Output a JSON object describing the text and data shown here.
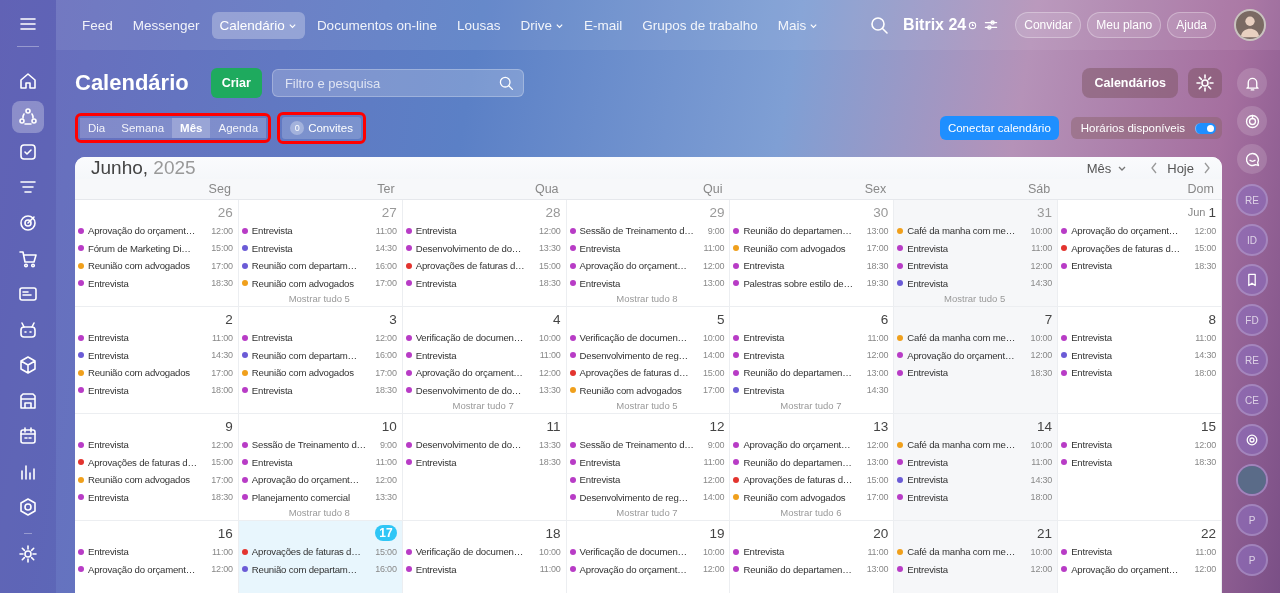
{
  "left_sidebar": {
    "items": [
      {
        "selected": false
      },
      {
        "selected": true
      },
      {
        "selected": false
      },
      {
        "selected": false
      },
      {
        "selected": false
      },
      {
        "selected": false
      },
      {
        "selected": false
      },
      {
        "selected": false
      },
      {
        "selected": false
      },
      {
        "selected": false
      },
      {
        "selected": false
      },
      {
        "selected": false
      },
      {
        "selected": false
      }
    ]
  },
  "top_nav": {
    "items": [
      {
        "label": "Feed",
        "selected": false,
        "dropdown": false
      },
      {
        "label": "Messenger",
        "selected": false,
        "dropdown": false
      },
      {
        "label": "Calendário",
        "selected": true,
        "dropdown": true
      },
      {
        "label": "Documentos on-line",
        "selected": false,
        "dropdown": false
      },
      {
        "label": "Lousas",
        "selected": false,
        "dropdown": false
      },
      {
        "label": "Drive",
        "selected": false,
        "dropdown": true
      },
      {
        "label": "E-mail",
        "selected": false,
        "dropdown": false
      },
      {
        "label": "Grupos de trabalho",
        "selected": false,
        "dropdown": false
      },
      {
        "label": "Mais",
        "selected": false,
        "dropdown": true
      }
    ],
    "logo": {
      "name": "Bitrix",
      "number": "24"
    },
    "buttons": [
      "Convidar",
      "Meu plano",
      "Ajuda"
    ]
  },
  "page": {
    "title": "Calendário",
    "create_button": "Criar",
    "search": {
      "placeholder": "Filtro e pesquisa"
    },
    "calendars_button": "Calendários",
    "views": [
      {
        "label": "Dia",
        "selected": false
      },
      {
        "label": "Semana",
        "selected": false
      },
      {
        "label": "Mês",
        "selected": true
      },
      {
        "label": "Agenda",
        "selected": false
      }
    ],
    "invites": {
      "count": "0",
      "label": "Convites"
    },
    "connect_button": "Conectar calendário",
    "availability": {
      "label": "Horários disponíveis",
      "on": true
    }
  },
  "calendar": {
    "month": "Junho,",
    "year": "2025",
    "view_select": "Mês",
    "today_button": "Hoje",
    "weekdays": [
      "Seg",
      "Ter",
      "Qua",
      "Qui",
      "Sex",
      "Sáb",
      "Dom"
    ],
    "weeks": [
      {
        "days": [
          {
            "number": "26",
            "other_month": true,
            "today": false,
            "events": [
              {
                "title": "Aprovação do orçament…",
                "time": "12:00",
                "color": "#b83cc6"
              },
              {
                "title": "Fórum de Marketing Di…",
                "time": "15:00",
                "color": "#b83cc6"
              },
              {
                "title": "Reunião com advogados",
                "time": "17:00",
                "color": "#f0a01c"
              },
              {
                "title": "Entrevista",
                "time": "18:30",
                "color": "#b83cc6"
              }
            ]
          },
          {
            "number": "27",
            "other_month": true,
            "today": false,
            "events": [
              {
                "title": "Entrevista",
                "time": "11:00",
                "color": "#b83cc6"
              },
              {
                "title": "Entrevista",
                "time": "14:30",
                "color": "#6b5bd6"
              },
              {
                "title": "Reunião com departam…",
                "time": "16:00",
                "color": "#6b5bd6"
              },
              {
                "title": "Reunião com advogados",
                "time": "17:00",
                "color": "#f0a01c"
              }
            ],
            "more": "Mostrar tudo 5"
          },
          {
            "number": "28",
            "other_month": true,
            "today": false,
            "events": [
              {
                "title": "Entrevista",
                "time": "12:00",
                "color": "#b83cc6"
              },
              {
                "title": "Desenvolvimento de do…",
                "time": "13:30",
                "color": "#b83cc6"
              },
              {
                "title": "Aprovações de faturas d…",
                "time": "15:00",
                "color": "#e3342f"
              },
              {
                "title": "Entrevista",
                "time": "18:30",
                "color": "#b83cc6"
              }
            ]
          },
          {
            "number": "29",
            "other_month": true,
            "today": false,
            "events": [
              {
                "title": "Sessão de Treinamento d…",
                "time": "9:00",
                "color": "#b83cc6"
              },
              {
                "title": "Entrevista",
                "time": "11:00",
                "color": "#b83cc6"
              },
              {
                "title": "Aprovação do orçament…",
                "time": "12:00",
                "color": "#b83cc6"
              },
              {
                "title": "Entrevista",
                "time": "13:00",
                "color": "#b83cc6"
              }
            ],
            "more": "Mostrar tudo 8"
          },
          {
            "number": "30",
            "other_month": true,
            "today": false,
            "events": [
              {
                "title": "Reunião do departamen…",
                "time": "13:00",
                "color": "#b83cc6"
              },
              {
                "title": "Reunião com advogados",
                "time": "17:00",
                "color": "#f0a01c"
              },
              {
                "title": "Entrevista",
                "time": "18:30",
                "color": "#b83cc6"
              },
              {
                "title": "Palestras sobre estilo de…",
                "time": "19:30",
                "color": "#b83cc6"
              }
            ]
          },
          {
            "number": "31",
            "other_month": true,
            "today": false,
            "events": [
              {
                "title": "Café da manha com me…",
                "time": "10:00",
                "color": "#f0a01c"
              },
              {
                "title": "Entrevista",
                "time": "11:00",
                "color": "#b83cc6"
              },
              {
                "title": "Entrevista",
                "time": "12:00",
                "color": "#b83cc6"
              },
              {
                "title": "Entrevista",
                "time": "14:30",
                "color": "#6b5bd6"
              }
            ],
            "more": "Mostrar tudo 5"
          },
          {
            "prefix": "Jun",
            "number": "1",
            "other_month": false,
            "today": false,
            "events": [
              {
                "title": "Aprovação do orçament…",
                "time": "12:00",
                "color": "#b83cc6"
              },
              {
                "title": "Aprovações de faturas d…",
                "time": "15:00",
                "color": "#e3342f"
              },
              {
                "title": "Entrevista",
                "time": "18:30",
                "color": "#b83cc6"
              }
            ]
          }
        ]
      },
      {
        "days": [
          {
            "number": "2",
            "other_month": false,
            "today": false,
            "events": [
              {
                "title": "Entrevista",
                "time": "11:00",
                "color": "#b83cc6"
              },
              {
                "title": "Entrevista",
                "time": "14:30",
                "color": "#6b5bd6"
              },
              {
                "title": "Reunião com advogados",
                "time": "17:00",
                "color": "#f0a01c"
              },
              {
                "title": "Entrevista",
                "time": "18:00",
                "color": "#b83cc6"
              }
            ]
          },
          {
            "number": "3",
            "other_month": false,
            "today": false,
            "events": [
              {
                "title": "Entrevista",
                "time": "12:00",
                "color": "#b83cc6"
              },
              {
                "title": "Reunião com departam…",
                "time": "16:00",
                "color": "#6b5bd6"
              },
              {
                "title": "Reunião com advogados",
                "time": "17:00",
                "color": "#f0a01c"
              },
              {
                "title": "Entrevista",
                "time": "18:30",
                "color": "#b83cc6"
              }
            ]
          },
          {
            "number": "4",
            "other_month": false,
            "today": false,
            "events": [
              {
                "title": "Verificação de documen…",
                "time": "10:00",
                "color": "#b83cc6"
              },
              {
                "title": "Entrevista",
                "time": "11:00",
                "color": "#b83cc6"
              },
              {
                "title": "Aprovação do orçament…",
                "time": "12:00",
                "color": "#b83cc6"
              },
              {
                "title": "Desenvolvimento de do…",
                "time": "13:30",
                "color": "#b83cc6"
              }
            ],
            "more": "Mostrar tudo 7"
          },
          {
            "number": "5",
            "other_month": false,
            "today": false,
            "events": [
              {
                "title": "Verificação de documen…",
                "time": "10:00",
                "color": "#b83cc6"
              },
              {
                "title": "Desenvolvimento de reg…",
                "time": "14:00",
                "color": "#b83cc6"
              },
              {
                "title": "Aprovações de faturas d…",
                "time": "15:00",
                "color": "#e3342f"
              },
              {
                "title": "Reunião com advogados",
                "time": "17:00",
                "color": "#f0a01c"
              }
            ],
            "more": "Mostrar tudo 5"
          },
          {
            "number": "6",
            "other_month": false,
            "today": false,
            "events": [
              {
                "title": "Entrevista",
                "time": "11:00",
                "color": "#b83cc6"
              },
              {
                "title": "Entrevista",
                "time": "12:00",
                "color": "#b83cc6"
              },
              {
                "title": "Reunião do departamen…",
                "time": "13:00",
                "color": "#b83cc6"
              },
              {
                "title": "Entrevista",
                "time": "14:30",
                "color": "#6b5bd6"
              }
            ],
            "more": "Mostrar tudo 7"
          },
          {
            "number": "7",
            "other_month": false,
            "today": false,
            "events": [
              {
                "title": "Café da manha com me…",
                "time": "10:00",
                "color": "#f0a01c"
              },
              {
                "title": "Aprovação do orçament…",
                "time": "12:00",
                "color": "#b83cc6"
              },
              {
                "title": "Entrevista",
                "time": "18:30",
                "color": "#b83cc6"
              }
            ]
          },
          {
            "number": "8",
            "other_month": false,
            "today": false,
            "events": [
              {
                "title": "Entrevista",
                "time": "11:00",
                "color": "#b83cc6"
              },
              {
                "title": "Entrevista",
                "time": "14:30",
                "color": "#6b5bd6"
              },
              {
                "title": "Entrevista",
                "time": "18:00",
                "color": "#b83cc6"
              }
            ]
          }
        ]
      },
      {
        "days": [
          {
            "number": "9",
            "other_month": false,
            "today": false,
            "events": [
              {
                "title": "Entrevista",
                "time": "12:00",
                "color": "#b83cc6"
              },
              {
                "title": "Aprovações de faturas d…",
                "time": "15:00",
                "color": "#e3342f"
              },
              {
                "title": "Reunião com advogados",
                "time": "17:00",
                "color": "#f0a01c"
              },
              {
                "title": "Entrevista",
                "time": "18:30",
                "color": "#b83cc6"
              }
            ]
          },
          {
            "number": "10",
            "other_month": false,
            "today": false,
            "events": [
              {
                "title": "Sessão de Treinamento d…",
                "time": "9:00",
                "color": "#b83cc6"
              },
              {
                "title": "Entrevista",
                "time": "11:00",
                "color": "#b83cc6"
              },
              {
                "title": "Aprovação do orçament…",
                "time": "12:00",
                "color": "#b83cc6"
              },
              {
                "title": "Planejamento comercial",
                "time": "13:30",
                "color": "#b83cc6"
              }
            ],
            "more": "Mostrar tudo 8"
          },
          {
            "number": "11",
            "other_month": false,
            "today": false,
            "events": [
              {
                "title": "Desenvolvimento de do…",
                "time": "13:30",
                "color": "#b83cc6"
              },
              {
                "title": "Entrevista",
                "time": "18:30",
                "color": "#b83cc6"
              }
            ]
          },
          {
            "number": "12",
            "other_month": false,
            "today": false,
            "events": [
              {
                "title": "Sessão de Treinamento d…",
                "time": "9:00",
                "color": "#b83cc6"
              },
              {
                "title": "Entrevista",
                "time": "11:00",
                "color": "#b83cc6"
              },
              {
                "title": "Entrevista",
                "time": "12:00",
                "color": "#b83cc6"
              },
              {
                "title": "Desenvolvimento de reg…",
                "time": "14:00",
                "color": "#b83cc6"
              }
            ],
            "more": "Mostrar tudo 7"
          },
          {
            "number": "13",
            "other_month": false,
            "today": false,
            "events": [
              {
                "title": "Aprovação do orçament…",
                "time": "12:00",
                "color": "#b83cc6"
              },
              {
                "title": "Reunião do departamen…",
                "time": "13:00",
                "color": "#b83cc6"
              },
              {
                "title": "Aprovações de faturas d…",
                "time": "15:00",
                "color": "#e3342f"
              },
              {
                "title": "Reunião com advogados",
                "time": "17:00",
                "color": "#f0a01c"
              }
            ],
            "more": "Mostrar tudo 6"
          },
          {
            "number": "14",
            "other_month": false,
            "today": false,
            "events": [
              {
                "title": "Café da manha com me…",
                "time": "10:00",
                "color": "#f0a01c"
              },
              {
                "title": "Entrevista",
                "time": "11:00",
                "color": "#b83cc6"
              },
              {
                "title": "Entrevista",
                "time": "14:30",
                "color": "#6b5bd6"
              },
              {
                "title": "Entrevista",
                "time": "18:00",
                "color": "#b83cc6"
              }
            ]
          },
          {
            "number": "15",
            "other_month": false,
            "today": false,
            "events": [
              {
                "title": "Entrevista",
                "time": "12:00",
                "color": "#b83cc6"
              },
              {
                "title": "Entrevista",
                "time": "18:30",
                "color": "#b83cc6"
              }
            ]
          }
        ]
      },
      {
        "days": [
          {
            "number": "16",
            "other_month": false,
            "today": false,
            "events": [
              {
                "title": "Entrevista",
                "time": "11:00",
                "color": "#b83cc6"
              },
              {
                "title": "Aprovação do orçament…",
                "time": "12:00",
                "color": "#b83cc6"
              }
            ]
          },
          {
            "number": "17",
            "other_month": false,
            "today": true,
            "events": [
              {
                "title": "Aprovações de faturas d…",
                "time": "15:00",
                "color": "#e3342f"
              },
              {
                "title": "Reunião com departam…",
                "time": "16:00",
                "color": "#6b5bd6"
              }
            ]
          },
          {
            "number": "18",
            "other_month": false,
            "today": false,
            "events": [
              {
                "title": "Verificação de documen…",
                "time": "10:00",
                "color": "#b83cc6"
              },
              {
                "title": "Entrevista",
                "time": "11:00",
                "color": "#b83cc6"
              }
            ]
          },
          {
            "number": "19",
            "other_month": false,
            "today": false,
            "events": [
              {
                "title": "Verificação de documen…",
                "time": "10:00",
                "color": "#b83cc6"
              },
              {
                "title": "Aprovação do orçament…",
                "time": "12:00",
                "color": "#b83cc6"
              }
            ]
          },
          {
            "number": "20",
            "other_month": false,
            "today": false,
            "events": [
              {
                "title": "Entrevista",
                "time": "11:00",
                "color": "#b83cc6"
              },
              {
                "title": "Reunião do departamen…",
                "time": "13:00",
                "color": "#b83cc6"
              }
            ]
          },
          {
            "number": "21",
            "other_month": false,
            "today": false,
            "events": [
              {
                "title": "Café da manha com me…",
                "time": "10:00",
                "color": "#f0a01c"
              },
              {
                "title": "Entrevista",
                "time": "12:00",
                "color": "#b83cc6"
              }
            ]
          },
          {
            "number": "22",
            "other_month": false,
            "today": false,
            "events": [
              {
                "title": "Entrevista",
                "time": "11:00",
                "color": "#b83cc6"
              },
              {
                "title": "Aprovação do orçament…",
                "time": "12:00",
                "color": "#b83cc6"
              }
            ]
          }
        ]
      }
    ]
  },
  "right_rail": {
    "avatars": [
      {
        "kind": "initials",
        "text": "RE"
      },
      {
        "kind": "initials",
        "text": "ID"
      },
      {
        "kind": "bookmark"
      },
      {
        "kind": "initials",
        "text": "FD"
      },
      {
        "kind": "initials",
        "text": "RE"
      },
      {
        "kind": "initials",
        "text": "CE"
      },
      {
        "kind": "spiral"
      },
      {
        "kind": "photo"
      },
      {
        "kind": "initials",
        "text": "P"
      },
      {
        "kind": "initials",
        "text": "P"
      }
    ]
  }
}
